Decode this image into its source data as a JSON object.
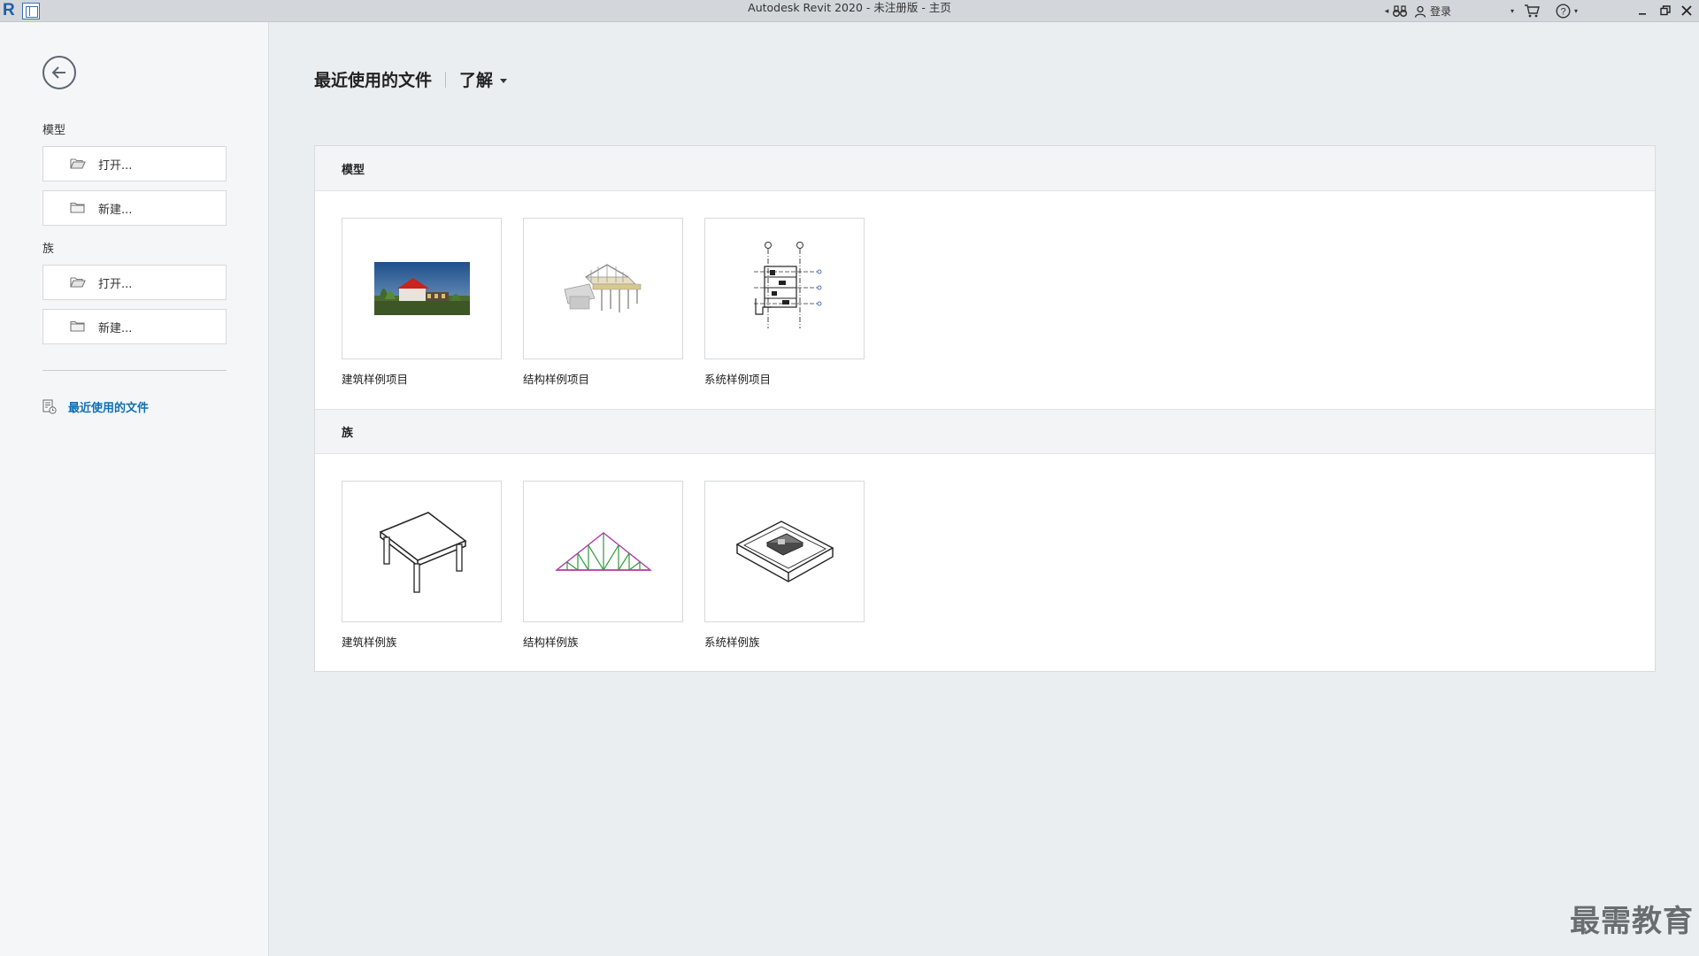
{
  "window": {
    "title": "Autodesk Revit 2020 - 未注册版 - 主页",
    "logo_letter": "R",
    "login_label": "登录"
  },
  "sidebar": {
    "model_section": "模型",
    "family_section": "族",
    "model_open": "打开...",
    "model_new": "新建...",
    "family_open": "打开...",
    "family_new": "新建...",
    "recent_link": "最近使用的文件"
  },
  "main": {
    "title": "最近使用的文件",
    "learn_tab": "了解",
    "models": {
      "header": "模型",
      "items": [
        {
          "label": "建筑样例项目",
          "icon": "architecture-render-thumbnail"
        },
        {
          "label": "结构样例项目",
          "icon": "structure-model-thumbnail"
        },
        {
          "label": "系统样例项目",
          "icon": "mep-system-thumbnail"
        }
      ]
    },
    "families": {
      "header": "族",
      "items": [
        {
          "label": "建筑样例族",
          "icon": "table-family-thumbnail"
        },
        {
          "label": "结构样例族",
          "icon": "truss-family-thumbnail"
        },
        {
          "label": "系统样例族",
          "icon": "system-tray-family-thumbnail"
        }
      ]
    }
  },
  "watermark": "最需教育",
  "colors": {
    "accent": "#0e6fb5",
    "background": "#ebeef1",
    "sidebar": "#f5f6f8",
    "titlebar": "#d3d6da"
  }
}
